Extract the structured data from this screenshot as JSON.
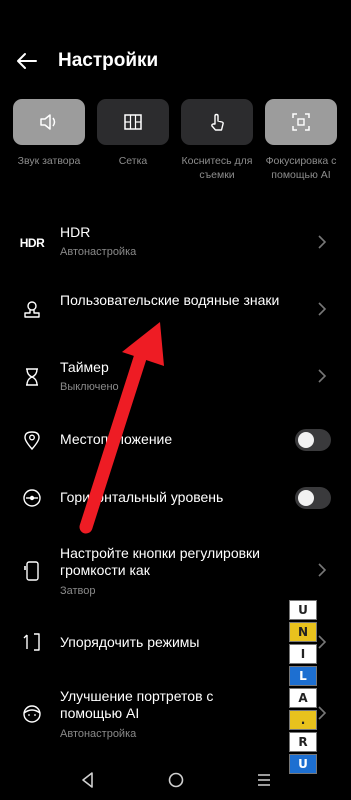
{
  "header": {
    "title": "Настройки"
  },
  "quick_actions": [
    {
      "label": "Звук затвора",
      "icon": "speaker-icon",
      "active": true
    },
    {
      "label": "Сетка",
      "icon": "grid-icon",
      "active": false
    },
    {
      "label": "Коснитесь для съемки",
      "icon": "touch-icon",
      "active": false
    },
    {
      "label": "Фокусировка с помощью AI",
      "icon": "focus-icon",
      "active": true
    }
  ],
  "settings": [
    {
      "title": "HDR",
      "subtitle": "Автонастройка",
      "icon": "hdr-icon",
      "control": "chevron"
    },
    {
      "title": "Пользовательские водяные знаки",
      "subtitle": "",
      "icon": "watermark-stamp-icon",
      "control": "chevron"
    },
    {
      "title": "Таймер",
      "subtitle": "Выключено",
      "icon": "hourglass-icon",
      "control": "chevron"
    },
    {
      "title": "Местоположение",
      "subtitle": "",
      "icon": "location-pin-icon",
      "control": "toggle",
      "state": "off"
    },
    {
      "title": "Горизонтальный уровень",
      "subtitle": "",
      "icon": "level-icon",
      "control": "toggle",
      "state": "off"
    },
    {
      "title": "Настройте кнопки регулировки громкости как",
      "subtitle": "Затвор",
      "icon": "phone-volume-icon",
      "control": "chevron"
    },
    {
      "title": "Упорядочить режимы",
      "subtitle": "",
      "icon": "sort-modes-icon",
      "control": "chevron"
    },
    {
      "title": "Улучшение портретов с помощью AI",
      "subtitle": "Автонастройка",
      "icon": "portrait-face-icon",
      "control": "chevron"
    }
  ],
  "watermark": {
    "letters": [
      "U",
      "N",
      "I",
      "L",
      "A",
      ".",
      "R",
      "U"
    ]
  },
  "colors": {
    "background": "#000000",
    "toggle_off": "#3a3a3c",
    "annotation_arrow": "#ee1c24"
  }
}
